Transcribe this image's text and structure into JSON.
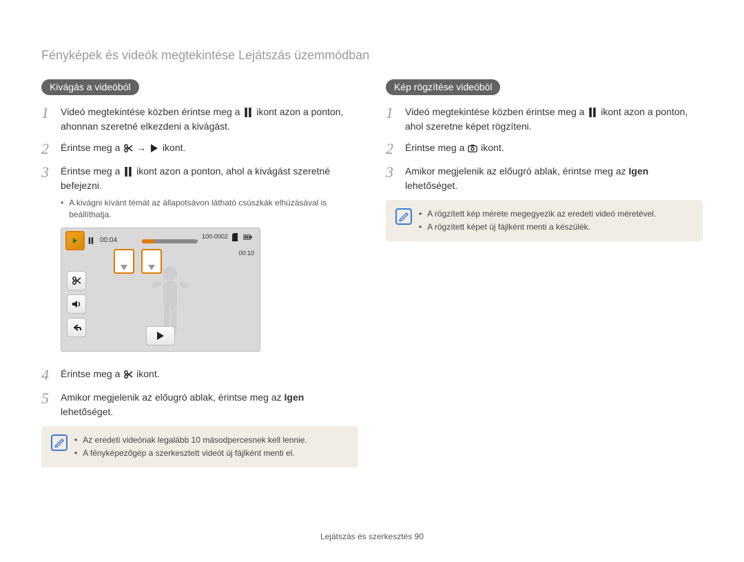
{
  "header": {
    "title": "Fényképek és videók megtekintése Lejátszás üzemmódban"
  },
  "left": {
    "pill": "Kivágás a videóból",
    "steps": {
      "s1_pre": "Videó megtekintése közben érintse meg a ",
      "s1_post": " ikont azon a ponton, ahonnan szeretné elkezdeni a kivágást.",
      "s2_pre": "Érintse meg a ",
      "s2_mid": " → ",
      "s2_post": " ikont.",
      "s3_pre": "Érintse meg a ",
      "s3_post": " ikont azon a ponton, ahol a kivágást szeretné befejezni.",
      "s3_sub": "A kivágni kívánt témát az állapotsávon látható csúszkák elhúzásával is beállíthatja.",
      "s4_pre": "Érintse meg a ",
      "s4_post": " ikont.",
      "s5_pre": "Amikor megjelenik az előugró ablak, érintse meg az ",
      "s5_strong": "Igen",
      "s5_post": " lehetőséget."
    },
    "note": {
      "l1": "Az eredeti videónak legalább 10 másodpercesnek kell lennie.",
      "l2": "A fényképezőgép a szerkesztett videót új fájlként menti el."
    },
    "device": {
      "time_left": "00:04",
      "file_id": "100-0002",
      "time_right": "00:10"
    }
  },
  "right": {
    "pill": "Kép rögzítése videóból",
    "steps": {
      "s1_pre": "Videó megtekintése közben érintse meg a ",
      "s1_post": " ikont azon a ponton, ahol szeretne képet rögzíteni.",
      "s2_pre": "Érintse meg a ",
      "s2_post": " ikont.",
      "s3_pre": "Amikor megjelenik az előugró ablak, érintse meg az ",
      "s3_strong": "Igen",
      "s3_post": " lehetőséget."
    },
    "note": {
      "l1": "A rögzített kép mérete megegyezik az eredeti videó méretével.",
      "l2": "A rögzített képet új fájlként menti a készülék."
    }
  },
  "footer": {
    "text": "Lejátszás és szerkesztés  90"
  },
  "nums": {
    "n1": "1",
    "n2": "2",
    "n3": "3",
    "n4": "4",
    "n5": "5"
  }
}
